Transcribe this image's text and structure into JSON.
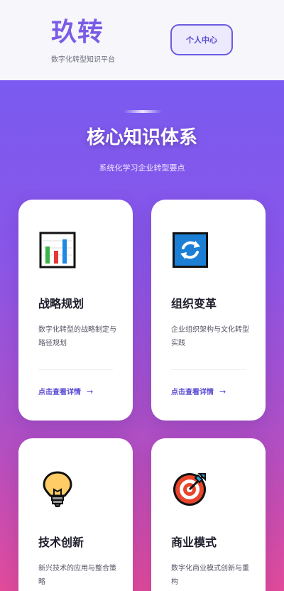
{
  "header": {
    "logo": "玖转",
    "tagline": "数字化转型知识平台",
    "user_center_label": "个人中心"
  },
  "section": {
    "title": "核心知识体系",
    "subtitle": "系统化学习企业转型要点"
  },
  "cards": [
    {
      "title": "战略规划",
      "desc": "数字化转型的战略制定与路径规划",
      "link": "点击查看详情",
      "icon": "bar-chart-icon"
    },
    {
      "title": "组织变革",
      "desc": "企业组织架构与文化转型实践",
      "link": "点击查看详情",
      "icon": "refresh-icon"
    },
    {
      "title": "技术创新",
      "desc": "新兴技术的应用与整合策略",
      "icon": "lightbulb-icon"
    },
    {
      "title": "商业模式",
      "desc": "数字化商业模式创新与重构",
      "icon": "target-icon"
    }
  ],
  "arrow_glyph": "→",
  "colors": {
    "accent": "#7b5ce6",
    "gradient_top": "#7a5af0",
    "gradient_bottom": "#e24b9a"
  }
}
